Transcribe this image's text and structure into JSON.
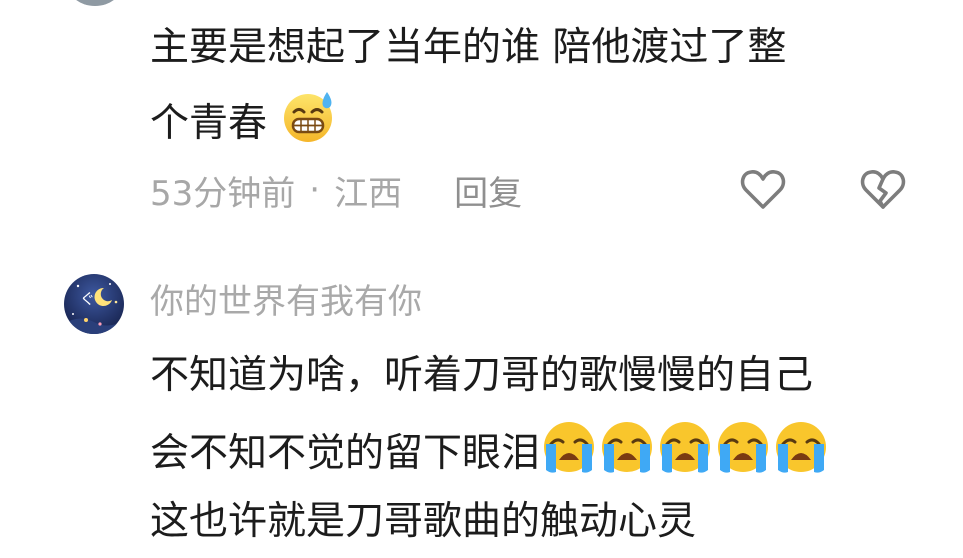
{
  "comment1": {
    "line1": "主要是想起了当年的谁 陪他渡过了整",
    "line2": "个青春",
    "emoji": "sweat-grin-emoji",
    "time": "53分钟前",
    "separator": "·",
    "location": "江西",
    "reply_label": "回复",
    "like_icon": "heart-outline-icon",
    "dislike_icon": "broken-heart-icon"
  },
  "comment2": {
    "username": "你的世界有我有你",
    "avatar_text": "ぐ",
    "line1": "不知道为啥，听着刀哥的歌慢慢的自己",
    "line2": "会不知不觉的留下眼泪",
    "line2_emoji": "loudly-crying-emoji",
    "line2_emoji_count": 5,
    "line3": "这也许就是刀哥歌曲的触动心灵"
  },
  "colors": {
    "text": "#1c1c1c",
    "meta": "#a7a7a7",
    "icon": "#7d7d7d",
    "emoji_yellow": "#f9c62c",
    "tear_blue": "#3fa9f5"
  }
}
